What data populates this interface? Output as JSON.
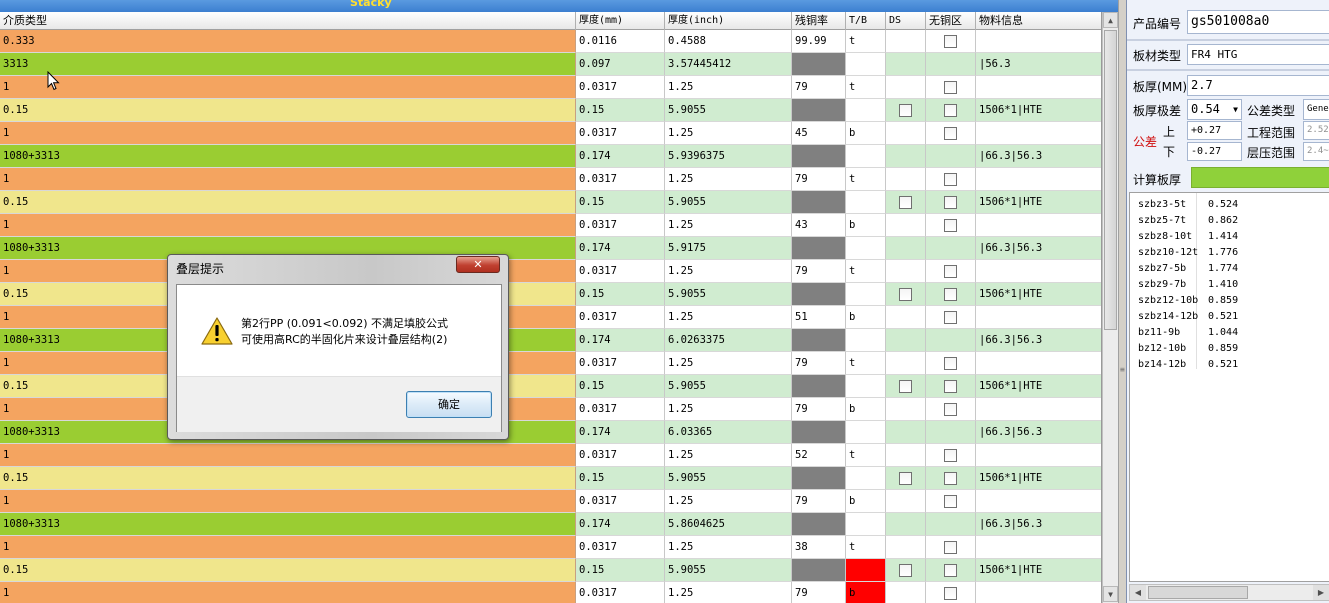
{
  "window": {
    "title_partial": "Stacky"
  },
  "grid": {
    "headers": [
      "介质类型",
      "厚度(mm)",
      "厚度(inch)",
      "残铜率",
      "T/B",
      "DS",
      "无铜区",
      "物料信息"
    ],
    "rows": [
      {
        "type": "0.333",
        "kind": "core",
        "mm": "0.0116",
        "inch": "0.4588",
        "rc": "99.99",
        "tb": "t",
        "ds": false,
        "nocu": true,
        "info": ""
      },
      {
        "type": "3313",
        "kind": "pp",
        "mm": "0.097",
        "inch": "3.57445412",
        "rc": "",
        "tb": "",
        "ds": false,
        "nocu": false,
        "info": "|56.3"
      },
      {
        "type": "1",
        "kind": "core",
        "mm": "0.0317",
        "inch": "1.25",
        "rc": "79",
        "tb": "t",
        "ds": false,
        "nocu": true,
        "info": ""
      },
      {
        "type": "0.15",
        "kind": "yellow",
        "mm": "0.15",
        "inch": "5.9055",
        "rc": "",
        "tb": "",
        "ds": true,
        "nocu": true,
        "info": "1506*1|HTE"
      },
      {
        "type": "1",
        "kind": "core",
        "mm": "0.0317",
        "inch": "1.25",
        "rc": "45",
        "tb": "b",
        "ds": false,
        "nocu": true,
        "info": ""
      },
      {
        "type": "1080+3313",
        "kind": "pp",
        "mm": "0.174",
        "inch": "5.9396375",
        "rc": "",
        "tb": "",
        "ds": false,
        "nocu": false,
        "info": "|66.3|56.3"
      },
      {
        "type": "1",
        "kind": "core",
        "mm": "0.0317",
        "inch": "1.25",
        "rc": "79",
        "tb": "t",
        "ds": false,
        "nocu": true,
        "info": ""
      },
      {
        "type": "0.15",
        "kind": "yellow",
        "mm": "0.15",
        "inch": "5.9055",
        "rc": "",
        "tb": "",
        "ds": true,
        "nocu": true,
        "info": "1506*1|HTE"
      },
      {
        "type": "1",
        "kind": "core",
        "mm": "0.0317",
        "inch": "1.25",
        "rc": "43",
        "tb": "b",
        "ds": false,
        "nocu": true,
        "info": ""
      },
      {
        "type": "1080+3313",
        "kind": "pp",
        "mm": "0.174",
        "inch": "5.9175",
        "rc": "",
        "tb": "",
        "ds": false,
        "nocu": false,
        "info": "|66.3|56.3"
      },
      {
        "type": "1",
        "kind": "core",
        "mm": "0.0317",
        "inch": "1.25",
        "rc": "79",
        "tb": "t",
        "ds": false,
        "nocu": true,
        "info": ""
      },
      {
        "type": "0.15",
        "kind": "yellow",
        "mm": "0.15",
        "inch": "5.9055",
        "rc": "",
        "tb": "",
        "ds": true,
        "nocu": true,
        "info": "1506*1|HTE"
      },
      {
        "type": "1",
        "kind": "core",
        "mm": "0.0317",
        "inch": "1.25",
        "rc": "51",
        "tb": "b",
        "ds": false,
        "nocu": true,
        "info": ""
      },
      {
        "type": "1080+3313",
        "kind": "pp",
        "mm": "0.174",
        "inch": "6.0263375",
        "rc": "",
        "tb": "",
        "ds": false,
        "nocu": false,
        "info": "|66.3|56.3"
      },
      {
        "type": "1",
        "kind": "core",
        "mm": "0.0317",
        "inch": "1.25",
        "rc": "79",
        "tb": "t",
        "ds": false,
        "nocu": true,
        "info": ""
      },
      {
        "type": "0.15",
        "kind": "yellow",
        "mm": "0.15",
        "inch": "5.9055",
        "rc": "",
        "tb": "",
        "ds": true,
        "nocu": true,
        "info": "1506*1|HTE"
      },
      {
        "type": "1",
        "kind": "core",
        "mm": "0.0317",
        "inch": "1.25",
        "rc": "79",
        "tb": "b",
        "ds": false,
        "nocu": true,
        "info": ""
      },
      {
        "type": "1080+3313",
        "kind": "pp",
        "mm": "0.174",
        "inch": "6.03365",
        "rc": "",
        "tb": "",
        "ds": false,
        "nocu": false,
        "info": "|66.3|56.3"
      },
      {
        "type": "1",
        "kind": "core",
        "mm": "0.0317",
        "inch": "1.25",
        "rc": "52",
        "tb": "t",
        "ds": false,
        "nocu": true,
        "info": ""
      },
      {
        "type": "0.15",
        "kind": "yellow",
        "mm": "0.15",
        "inch": "5.9055",
        "rc": "",
        "tb": "",
        "ds": true,
        "nocu": true,
        "info": "1506*1|HTE"
      },
      {
        "type": "1",
        "kind": "core",
        "mm": "0.0317",
        "inch": "1.25",
        "rc": "79",
        "tb": "b",
        "ds": false,
        "nocu": true,
        "info": ""
      },
      {
        "type": "1080+3313",
        "kind": "pp",
        "mm": "0.174",
        "inch": "5.8604625",
        "rc": "",
        "tb": "",
        "ds": false,
        "nocu": false,
        "info": "|66.3|56.3"
      },
      {
        "type": "1",
        "kind": "core",
        "mm": "0.0317",
        "inch": "1.25",
        "rc": "38",
        "tb": "t",
        "ds": false,
        "nocu": true,
        "info": ""
      },
      {
        "type": "0.15",
        "kind": "yellow",
        "mm": "0.15",
        "inch": "5.9055",
        "rc": "",
        "tb": "",
        "ds": true,
        "nocu": true,
        "info": "1506*1|HTE",
        "tbred": true
      },
      {
        "type": "1",
        "kind": "core",
        "mm": "0.0317",
        "inch": "1.25",
        "rc": "79",
        "tb": "b",
        "ds": false,
        "nocu": true,
        "info": "",
        "tbred": true
      }
    ]
  },
  "colors": {
    "core_type": "#f4a460",
    "pp_type": "#9acd32",
    "yellow_type": "#f0e68c",
    "green_cell": "#d0ecd0",
    "gray_cell": "#808080",
    "red_cell": "#ff0000"
  },
  "panel": {
    "product_label": "产品编号",
    "product_value": "gs501008a0",
    "board_type_label": "板材类型",
    "board_type_value": "FR4 HTG",
    "thickness_label": "板厚(MM)",
    "thickness_value": "2.7",
    "tol_label": "板厚极差",
    "tol_value": "0.54",
    "tol_type_label": "公差类型",
    "tol_type_value": "Gene",
    "tol_group_label": "公差",
    "upper_label": "上",
    "upper_value": "+0.27",
    "lower_label": "下",
    "lower_value": "-0.27",
    "eng_range_label": "工程范围",
    "eng_range_value": "2.52",
    "press_range_label": "层压范围",
    "press_range_value": "2.4~",
    "calc_label": "计算板厚",
    "list": [
      {
        "name": "szbz3-5t",
        "value": "0.524"
      },
      {
        "name": "szbz5-7t",
        "value": "0.862"
      },
      {
        "name": "szbz8-10t",
        "value": "1.414"
      },
      {
        "name": "szbz10-12t",
        "value": "1.776"
      },
      {
        "name": "szbz7-5b",
        "value": "1.774"
      },
      {
        "name": "szbz9-7b",
        "value": "1.410"
      },
      {
        "name": "szbz12-10b",
        "value": "0.859"
      },
      {
        "name": "szbz14-12b",
        "value": "0.521"
      },
      {
        "name": "bz11-9b",
        "value": "1.044"
      },
      {
        "name": "bz12-10b",
        "value": "0.859"
      },
      {
        "name": "bz14-12b",
        "value": "0.521"
      }
    ]
  },
  "dialog": {
    "title": "叠层提示",
    "close_label": "✕",
    "line1": "第2行PP (0.091<0.092) 不满足填胶公式",
    "line2": "可使用高RC的半固化片来设计叠层结构(2)",
    "ok_label": "确定"
  },
  "icons": {
    "close": "close-icon",
    "warning": "warning-icon",
    "checkbox": "checkbox-icon",
    "dropdown": "chevron-down-icon",
    "cursor": "mouse-cursor-icon"
  }
}
